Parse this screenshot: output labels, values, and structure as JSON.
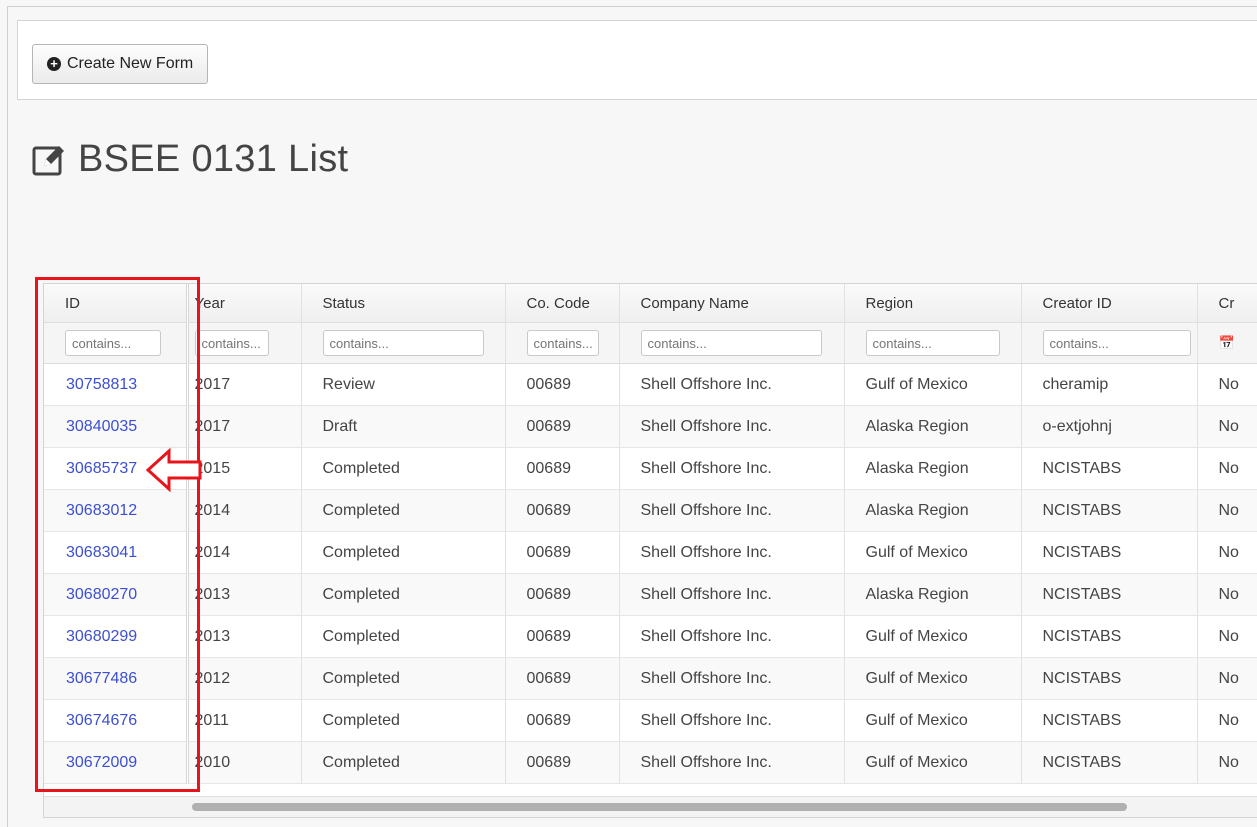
{
  "toolbar": {
    "create_label": "Create New Form"
  },
  "page": {
    "title": "BSEE 0131 List"
  },
  "table": {
    "columns": [
      "ID",
      "Year",
      "Status",
      "Co. Code",
      "Company Name",
      "Region",
      "Creator ID",
      "Cr"
    ],
    "filter_placeholder": "contains...",
    "rows": [
      [
        "30758813",
        "2017",
        "Review",
        "00689",
        "Shell Offshore Inc.",
        "Gulf of Mexico",
        "cheramip",
        "No"
      ],
      [
        "30840035",
        "2017",
        "Draft",
        "00689",
        "Shell Offshore Inc.",
        "Alaska Region",
        "o-extjohnj",
        "No"
      ],
      [
        "30685737",
        "2015",
        "Completed",
        "00689",
        "Shell Offshore Inc.",
        "Alaska Region",
        "NCISTABS",
        "No"
      ],
      [
        "30683012",
        "2014",
        "Completed",
        "00689",
        "Shell Offshore Inc.",
        "Alaska Region",
        "NCISTABS",
        "No"
      ],
      [
        "30683041",
        "2014",
        "Completed",
        "00689",
        "Shell Offshore Inc.",
        "Gulf of Mexico",
        "NCISTABS",
        "No"
      ],
      [
        "30680270",
        "2013",
        "Completed",
        "00689",
        "Shell Offshore Inc.",
        "Alaska Region",
        "NCISTABS",
        "No"
      ],
      [
        "30680299",
        "2013",
        "Completed",
        "00689",
        "Shell Offshore Inc.",
        "Gulf of Mexico",
        "NCISTABS",
        "No"
      ],
      [
        "30677486",
        "2012",
        "Completed",
        "00689",
        "Shell Offshore Inc.",
        "Gulf of Mexico",
        "NCISTABS",
        "No"
      ],
      [
        "30674676",
        "2011",
        "Completed",
        "00689",
        "Shell Offshore Inc.",
        "Gulf of Mexico",
        "NCISTABS",
        "No"
      ],
      [
        "30672009",
        "2010",
        "Completed",
        "00689",
        "Shell Offshore Inc.",
        "Gulf of Mexico",
        "NCISTABS",
        "No"
      ]
    ]
  },
  "annotation": {
    "color": "#e8141b"
  },
  "icons": {
    "create": "plus-circle-icon",
    "title": "edit-icon",
    "filter_date": "calendar-icon"
  }
}
